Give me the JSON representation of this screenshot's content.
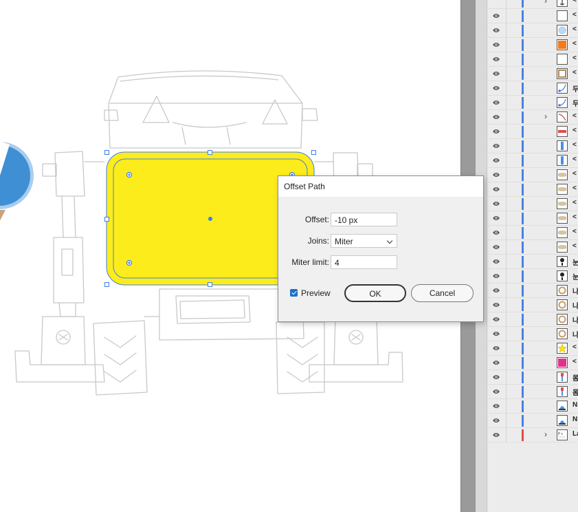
{
  "dialog": {
    "title": "Offset Path",
    "offset_label": "Offset:",
    "offset_value": "-10 px",
    "joins_label": "Joins:",
    "joins_value": "Miter",
    "miter_label": "Miter limit:",
    "miter_value": "4",
    "preview_label": "Preview",
    "preview_checked": true,
    "ok_label": "OK",
    "cancel_label": "Cancel"
  },
  "colors": {
    "selection_blue": "#3d7fe6",
    "shape_fill": "#fcec1c",
    "checkbox_blue": "#1f6fc5",
    "layer_color_blue": "#4a80e8",
    "layer_color_red": "#e24b4b"
  },
  "layers": [
    {
      "name": "<",
      "expandable": true,
      "thumb": "figure-thumb",
      "color": "blue",
      "partial": true
    },
    {
      "name": "<",
      "expandable": false,
      "thumb": "blank-thumb",
      "color": "blue"
    },
    {
      "name": "<",
      "expandable": false,
      "thumb": "burst-thumb",
      "color": "blue"
    },
    {
      "name": "<",
      "expandable": false,
      "thumb": "orange-thumb",
      "color": "blue"
    },
    {
      "name": "<",
      "expandable": false,
      "thumb": "blank-thumb",
      "color": "blue"
    },
    {
      "name": "<",
      "expandable": false,
      "thumb": "frame-thumb",
      "color": "blue"
    },
    {
      "name": "두",
      "expandable": false,
      "thumb": "arc-thumb",
      "color": "blue"
    },
    {
      "name": "두",
      "expandable": false,
      "thumb": "arc-thumb",
      "color": "blue"
    },
    {
      "name": "<",
      "expandable": true,
      "thumb": "curve-thumb",
      "color": "blue"
    },
    {
      "name": "<",
      "expandable": false,
      "thumb": "redbar-thumb",
      "color": "blue"
    },
    {
      "name": "<",
      "expandable": false,
      "thumb": "bluebar-thumb",
      "color": "blue"
    },
    {
      "name": "<",
      "expandable": false,
      "thumb": "bluebar-thumb",
      "color": "blue"
    },
    {
      "name": "<",
      "expandable": false,
      "thumb": "tan-thumb",
      "color": "blue"
    },
    {
      "name": "<",
      "expandable": false,
      "thumb": "tan-thumb",
      "color": "blue"
    },
    {
      "name": "<",
      "expandable": false,
      "thumb": "tan-thumb",
      "color": "blue"
    },
    {
      "name": "<",
      "expandable": false,
      "thumb": "tan-thumb",
      "color": "blue"
    },
    {
      "name": "<",
      "expandable": false,
      "thumb": "tan-thumb",
      "color": "blue"
    },
    {
      "name": "<",
      "expandable": false,
      "thumb": "tan-thumb",
      "color": "blue"
    },
    {
      "name": "눈",
      "expandable": false,
      "thumb": "eye-thumb",
      "color": "blue"
    },
    {
      "name": "눈",
      "expandable": false,
      "thumb": "eye-thumb",
      "color": "blue"
    },
    {
      "name": "나",
      "expandable": false,
      "thumb": "ring-thumb",
      "color": "blue"
    },
    {
      "name": "나",
      "expandable": false,
      "thumb": "ring-thumb",
      "color": "blue"
    },
    {
      "name": "나",
      "expandable": false,
      "thumb": "ring-thumb",
      "color": "blue"
    },
    {
      "name": "나",
      "expandable": false,
      "thumb": "ring-thumb",
      "color": "blue"
    },
    {
      "name": "<",
      "expandable": false,
      "thumb": "star-thumb",
      "color": "blue"
    },
    {
      "name": "<",
      "expandable": false,
      "thumb": "magenta-thumb",
      "color": "blue"
    },
    {
      "name": "몸",
      "expandable": false,
      "thumb": "robot-thumb",
      "color": "blue"
    },
    {
      "name": "몸",
      "expandable": false,
      "thumb": "robot-thumb",
      "color": "blue"
    },
    {
      "name": "N",
      "expandable": false,
      "thumb": "blue-figure-thumb",
      "color": "blue"
    },
    {
      "name": "N",
      "expandable": false,
      "thumb": "blue-figure-thumb",
      "color": "blue"
    },
    {
      "name": "La",
      "expandable": true,
      "thumb": "layer-thumb",
      "color": "red"
    }
  ]
}
